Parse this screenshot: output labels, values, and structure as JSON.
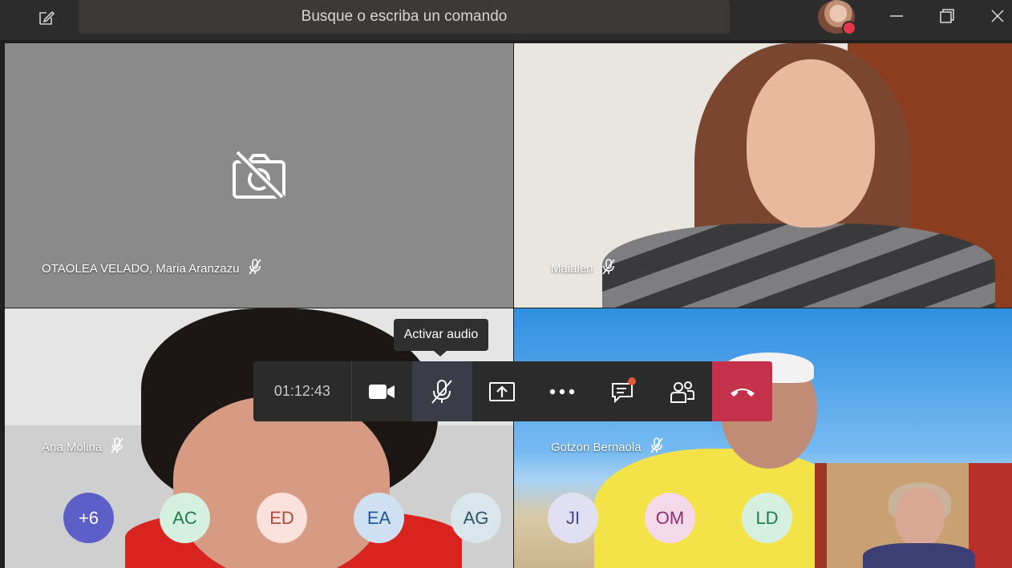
{
  "titlebar": {
    "search_placeholder": "Busque o escriba un comando"
  },
  "tiles": [
    {
      "name": "OTAOLEA VELADO, Maria Aranzazu",
      "muted": true,
      "camera_off": true
    },
    {
      "name": "Maialen",
      "muted": true
    },
    {
      "name": "Ana Molina",
      "muted": true
    },
    {
      "name": "Gotzon Bernaola",
      "muted": true
    }
  ],
  "controls": {
    "tooltip": "Activar audio",
    "timer": "01:12:43",
    "hangup_color": "#c4314b"
  },
  "participants": [
    {
      "label": "+6",
      "bg": "#5b5fc7",
      "fg": "#ffffff"
    },
    {
      "label": "AC",
      "bg": "#d5efe0",
      "fg": "#1f7a4b"
    },
    {
      "label": "ED",
      "bg": "#fbe1dc",
      "fg": "#b24b3a"
    },
    {
      "label": "EA",
      "bg": "#cfe0f2",
      "fg": "#1d5894"
    },
    {
      "label": "AG",
      "bg": "#d9e6ec",
      "fg": "#2c5466"
    },
    {
      "label": "JI",
      "bg": "#e1e0f2",
      "fg": "#47459a"
    },
    {
      "label": "OM",
      "bg": "#f3d9ea",
      "fg": "#8f2f71"
    },
    {
      "label": "LD",
      "bg": "#d5efe0",
      "fg": "#1f7a4b"
    }
  ]
}
